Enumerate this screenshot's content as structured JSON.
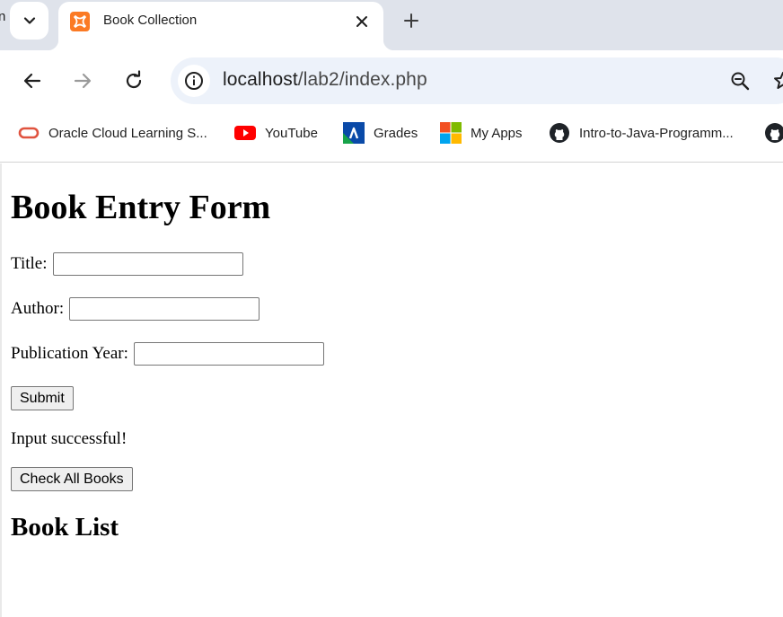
{
  "browser": {
    "edge_fragment": "n",
    "tab": {
      "title": "Book Collection"
    },
    "address_bar": {
      "host": "localhost",
      "path": "/lab2/index.php"
    },
    "bookmarks": [
      {
        "label": "Oracle Cloud Learning S...",
        "icon": "oracle-icon"
      },
      {
        "label": "YouTube",
        "icon": "youtube-icon"
      },
      {
        "label": "Grades",
        "icon": "grades-icon"
      },
      {
        "label": "My Apps",
        "icon": "microsoft-apps-icon"
      },
      {
        "label": "Intro-to-Java-Programm...",
        "icon": "github-icon"
      },
      {
        "label": "",
        "icon": "github-icon"
      }
    ]
  },
  "page": {
    "heading": "Book Entry Form",
    "fields": {
      "title_label": "Title:",
      "title_value": "",
      "author_label": "Author:",
      "author_value": "",
      "year_label": "Publication Year:",
      "year_value": ""
    },
    "submit_label": "Submit",
    "status_message": "Input successful!",
    "check_all_label": "Check All Books",
    "list_heading": "Book List"
  },
  "colors": {
    "tabstrip_bg": "#dfe3eb",
    "omnibox_bg": "#edf2fa",
    "xampp_orange": "#fb7a24",
    "youtube_red": "#ff0000",
    "oracle_red": "#e0533f"
  }
}
